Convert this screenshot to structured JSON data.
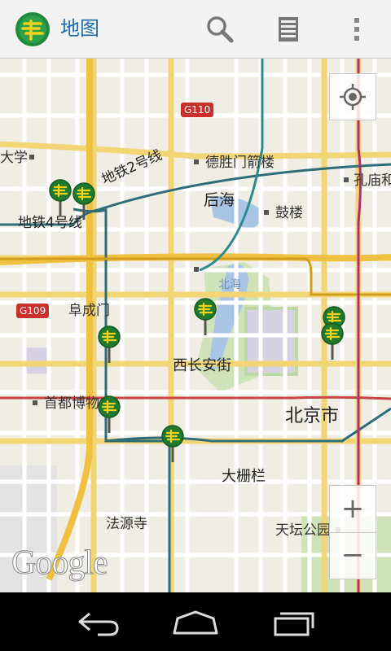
{
  "app": {
    "title": "地图"
  },
  "map": {
    "labels": {
      "g110": "G110",
      "g109": "G109",
      "daxue": "大学",
      "deshengmen": "德胜门箭楼",
      "kongmiao": "孔庙和",
      "subway2": "地铁2号线",
      "subway4": "地铁4号线",
      "houhai": "后海",
      "gulou": "鼓楼",
      "beihai": "北海",
      "fuchengmen": "阜成门",
      "xichanganjie": "西长安街",
      "shoudu": "首都博物",
      "beijingshi": "北京市",
      "dashilan": "大栅栏",
      "fayuansi": "法源寺",
      "tiantan": "天坛公园"
    },
    "watermark": "Google",
    "controls": {
      "zoom_in": "+",
      "zoom_out": "−"
    }
  },
  "colors": {
    "accent": "#1a6bb0",
    "marker_green": "#2e8b2e"
  }
}
